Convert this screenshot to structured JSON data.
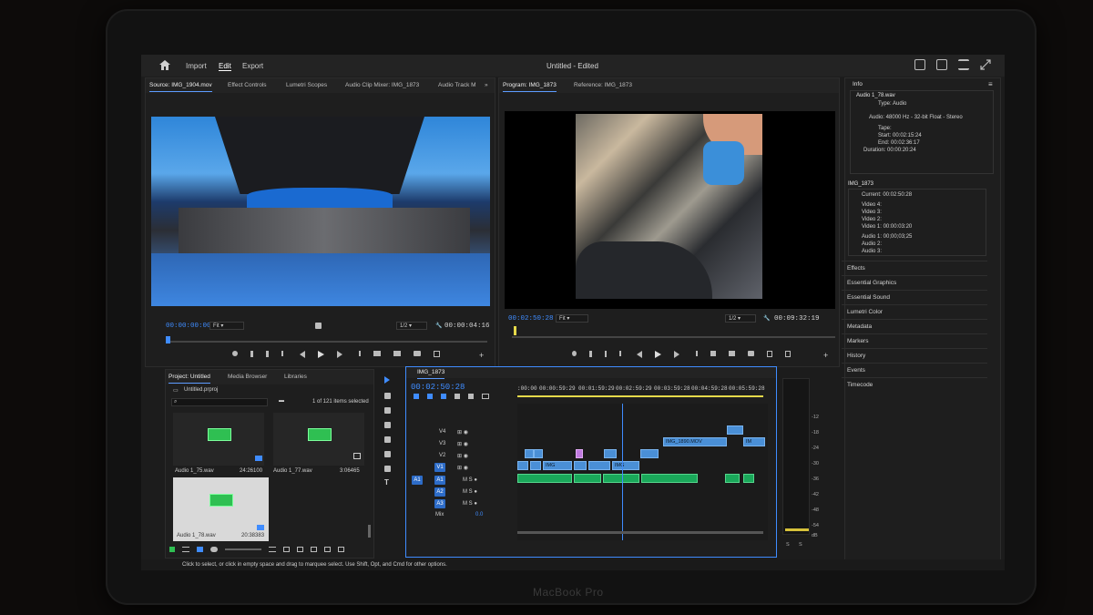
{
  "app": {
    "title": "Untitled - Edited",
    "nav": {
      "import": "Import",
      "edit": "Edit",
      "export": "Export"
    }
  },
  "source_panel": {
    "tabs": [
      "Source: IMG_1904.mov",
      "Effect Controls",
      "Lumetri Scopes",
      "Audio Clip Mixer: IMG_1873",
      "Audio Track M"
    ],
    "timecode": "00:00:00:00",
    "fit": "Fit",
    "resolution": "1/2",
    "duration": "00:00:04:16"
  },
  "program_panel": {
    "tabs": [
      "Program: IMG_1873",
      "Reference: IMG_1873"
    ],
    "timecode": "00:02:50:28",
    "fit": "Fit",
    "resolution": "1/2",
    "duration": "00:09:32:19"
  },
  "info_panel": {
    "title": "Info",
    "clip_name": "Audio 1_78.wav",
    "lines": [
      "Type:  Audio",
      "Audio:  48000 Hz - 32-bit Float - Stereo",
      "Tape:",
      "Start:  00:02:15:24",
      "End:  00:02:36:17",
      "Duration:  00:00:20:24"
    ],
    "seq_name": "IMG_1873",
    "seq_lines": [
      "Current:  00:02:50:28",
      "Video 4:",
      "Video 3:",
      "Video 2:",
      "Video 1:  00:00:03:20",
      "Audio 1:  00;00;03;25",
      "Audio 2:",
      "Audio 3:"
    ],
    "side_items": [
      "Effects",
      "Essential Graphics",
      "Essential Sound",
      "Lumetri Color",
      "Metadata",
      "Markers",
      "History",
      "Events",
      "Timecode"
    ]
  },
  "project_panel": {
    "tabs": [
      "Project: Untitled",
      "Media Browser",
      "Libraries"
    ],
    "file": "Untitled.prproj",
    "items_selected": "1 of 121 items selected",
    "clips": [
      {
        "name": "Audio 1_75.wav",
        "duration": "24:26100"
      },
      {
        "name": "Audio 1_77.wav",
        "duration": "3:06465"
      },
      {
        "name": "Audio 1_78.wav",
        "duration": "20:38383"
      }
    ]
  },
  "timeline": {
    "sequence_tab": "IMG_1873",
    "timecode": "00:02:50:28",
    "ruler": [
      ":00:00",
      "00:00:59:29",
      "00:01:59:29",
      "00:02:59:29",
      "00:03:59:28",
      "00:04:59:28",
      "00:05:59:28"
    ],
    "video_tracks": [
      "V4",
      "V3",
      "V2",
      "V1"
    ],
    "audio_tracks": [
      "A1",
      "A2",
      "A3"
    ],
    "source_patch_v": "V1",
    "source_patch_a": "A1",
    "mix_label": "Mix",
    "mix_value": "0.0",
    "clip_labels": [
      "IMG_1890.MOV",
      "IM",
      "IMG",
      "IMG"
    ],
    "meter_scale": [
      "-12",
      "-18",
      "-24",
      "-30",
      "-36",
      "-42",
      "-48",
      "-54",
      "dB"
    ],
    "meter_footer": [
      "S",
      "S"
    ]
  },
  "status": {
    "text": "Click to select, or click in empty space and drag to marquee select. Use Shift, Opt, and Cmd for other options."
  },
  "device": {
    "label": "MacBook Pro"
  },
  "colors": {
    "accent": "#3f8cff",
    "video_clip": "#4a8fd6",
    "audio_clip": "#1aa85a",
    "playhead": "#3f8cff"
  }
}
